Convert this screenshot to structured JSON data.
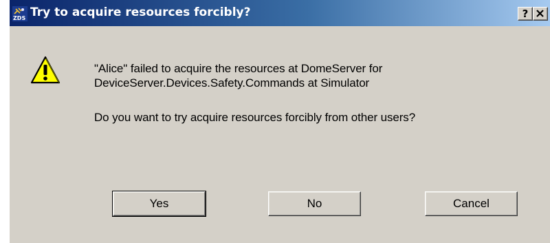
{
  "titlebar": {
    "title": "Try to acquire resources forcibly?",
    "app_icon_text": "ZDS",
    "help_label": "?",
    "close_label": "✕"
  },
  "message": {
    "line1": "\"Alice\" failed to acquire the resources at DomeServer for",
    "line2": "DeviceServer.Devices.Safety.Commands at Simulator",
    "question": "Do you want to try acquire resources forcibly from other users?"
  },
  "buttons": {
    "yes": "Yes",
    "no": "No",
    "cancel": "Cancel"
  },
  "colors": {
    "titlebar_start": "#0a246a",
    "titlebar_end": "#a6caf0",
    "dialog_bg": "#d4d0c8",
    "warning_yellow": "#ffff00"
  },
  "icons": {
    "app": "zds-app-icon",
    "warning": "warning-icon"
  }
}
